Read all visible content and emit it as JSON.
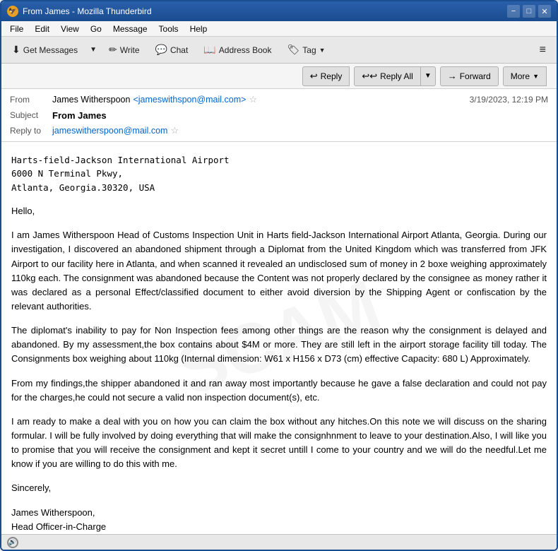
{
  "window": {
    "title": "From James - Mozilla Thunderbird",
    "icon": "🦅"
  },
  "titlebar": {
    "minimize_label": "−",
    "maximize_label": "□",
    "close_label": "✕"
  },
  "menubar": {
    "items": [
      "File",
      "Edit",
      "View",
      "Go",
      "Message",
      "Tools",
      "Help"
    ]
  },
  "toolbar": {
    "get_messages_label": "Get Messages",
    "write_label": "Write",
    "chat_label": "Chat",
    "address_book_label": "Address Book",
    "tag_label": "Tag",
    "menu_icon": "≡"
  },
  "actions": {
    "reply_label": "Reply",
    "reply_all_label": "Reply All",
    "forward_label": "Forward",
    "more_label": "More"
  },
  "email": {
    "from_label": "From",
    "from_name": "James Witherspoon",
    "from_email": "<jameswithspon@mail.com>",
    "subject_label": "Subject",
    "subject": "From James",
    "reply_to_label": "Reply to",
    "reply_to_email": "jameswitherspoon@mail.com",
    "date": "3/19/2023, 12:19 PM",
    "body_address": "Harts-field-Jackson International Airport\n6000 N Terminal Pkwy,\nAtlanta, Georgia.30320, USA",
    "body_greeting": "Hello,",
    "body_p1": "I am James Witherspoon Head of Customs Inspection Unit in Harts field-Jackson International Airport Atlanta, Georgia. During our investigation, I discovered an abandoned shipment through a Diplomat from the United Kingdom which was transferred from JFK Airport to our facility here in Atlanta, and when scanned it revealed an undisclosed sum of money in 2 boxe weighing approximately 110kg each. The consignment was abandoned because the Content was not properly declared by the consignee as money rather it was declared as a personal Effect/classified document to either avoid diversion by the Shipping Agent or confiscation by the relevant authorities.",
    "body_p2": "The diplomat's inability to pay for Non Inspection fees among other things are the reason why the consignment is delayed and abandoned. By my assessment,the box contains about $4M or more. They are still left in the airport storage facility till today. The Consignments box weighing about 110kg (Internal dimension: W61 x H156 x D73 (cm) effective Capacity: 680 L) Approximately.",
    "body_p3": "From my findings,the shipper abandoned it and ran away most importantly because he gave a false declaration and could not pay for the charges,he could not secure a valid non inspection document(s), etc.",
    "body_p4": "I am ready to make a deal with you on how you can claim the box without any hitches.On this note we will discuss on the sharing formular. I will be fully involved by doing everything that will make the consignhnment to leave to your destination.Also, I will like you to promise that you will receive the consignment and kept it secret untill I come to your country and we will do the needful.Let me know if you are willing to do this with me.",
    "body_closing": "Sincerely,",
    "body_signature1": "James Witherspoon,",
    "body_signature2": "Head Officer-in-Charge"
  },
  "statusbar": {
    "icon_label": "🔊"
  }
}
